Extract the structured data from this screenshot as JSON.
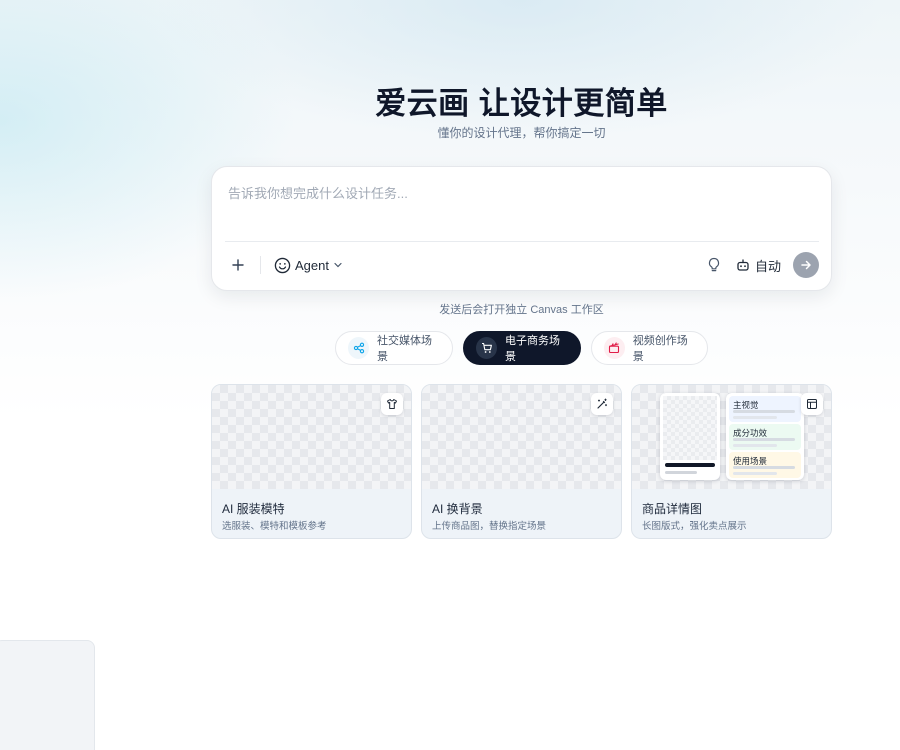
{
  "hero": {
    "title": "爱云画 让设计更简单",
    "subtitle": "懂你的设计代理，帮你搞定一切"
  },
  "composer": {
    "placeholder": "告诉我你想完成什么设计任务...",
    "agent_label": "Agent",
    "auto_label": "自动",
    "icons": [
      "plus-icon",
      "smile-icon",
      "chevron-down-icon",
      "lightbulb-icon",
      "robot-icon",
      "arrow-right-icon"
    ]
  },
  "hint": "发送后会打开独立 Canvas 工作区",
  "scenes": [
    {
      "label": "社交媒体场景",
      "icon": "share-icon",
      "active": false
    },
    {
      "label": "电子商务场景",
      "icon": "cart-icon",
      "active": true
    },
    {
      "label": "视频创作场景",
      "icon": "clapperboard-icon",
      "active": false
    }
  ],
  "cards": [
    {
      "title": "AI 服装模特",
      "desc": "选服装、模特和模板参考",
      "icon": "shirt-icon"
    },
    {
      "title": "AI 换背景",
      "desc": "上传商品图，替换指定场景",
      "icon": "magic-wand-icon"
    },
    {
      "title": "商品详情图",
      "desc": "长图版式，强化卖点展示",
      "icon": "layout-icon",
      "preview_rows": [
        "主视觉",
        "成分功效",
        "使用场景"
      ]
    }
  ],
  "colors": {
    "dark": "#0f172a",
    "send_button": "#9ca3af",
    "muted_text": "#64748b"
  }
}
